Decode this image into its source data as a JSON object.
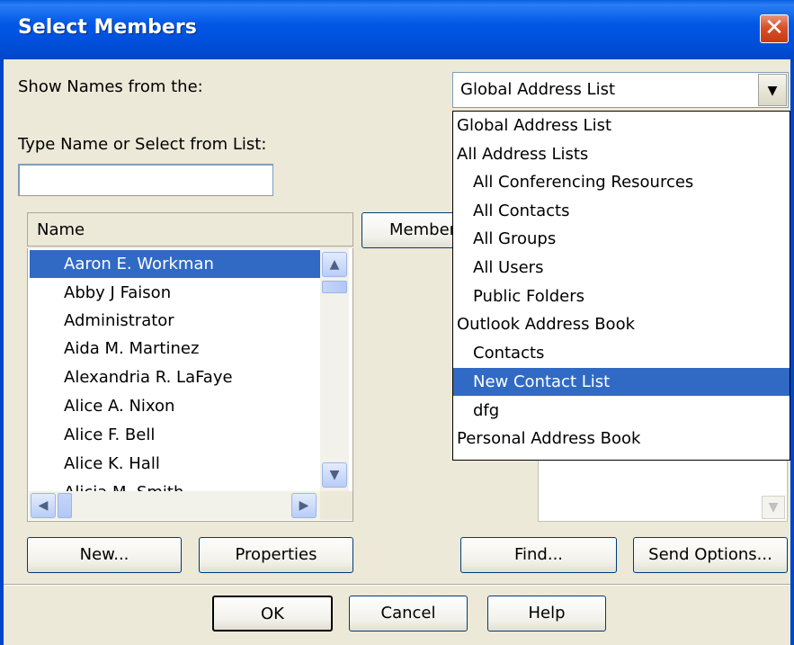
{
  "window": {
    "title": "Select Members",
    "close_glyph": "✕"
  },
  "show_names": {
    "label": "Show Names from the:",
    "selected": "Global Address List"
  },
  "search": {
    "label": "Type Name or Select from List:",
    "value": ""
  },
  "name_list": {
    "column_header": "Name",
    "rows": [
      "Aaron E. Workman",
      "Abby J Faison",
      "Administrator",
      "Aida M. Martinez",
      "Alexandria R. LaFaye",
      "Alice A. Nixon",
      "Alice F. Bell",
      "Alice K. Hall",
      "Alicia M. Smith"
    ],
    "selected_index": 0
  },
  "members_button": "Members",
  "dropdown_options": [
    {
      "label": "Global Address List",
      "level": 0
    },
    {
      "label": "All Address Lists",
      "level": 0
    },
    {
      "label": "All Conferencing Resources",
      "level": 1
    },
    {
      "label": "All Contacts",
      "level": 1
    },
    {
      "label": "All Groups",
      "level": 1
    },
    {
      "label": "All Users",
      "level": 1
    },
    {
      "label": "Public Folders",
      "level": 1
    },
    {
      "label": "Outlook Address Book",
      "level": 0
    },
    {
      "label": "Contacts",
      "level": 1
    },
    {
      "label": "New Contact List",
      "level": 1,
      "highlighted": true
    },
    {
      "label": "dfg",
      "level": 1
    },
    {
      "label": "Personal Address Book",
      "level": 0
    }
  ],
  "buttons": {
    "new": "New...",
    "properties": "Properties",
    "find": "Find...",
    "send_options": "Send Options...",
    "ok": "OK",
    "cancel": "Cancel",
    "help": "Help"
  },
  "colors": {
    "titlebar": "#0058e6",
    "selection": "#316ac5",
    "dialog_bg": "#ece9d8"
  },
  "icons": {
    "close": "close-icon",
    "dropdown_arrow": "chevron-down-icon",
    "scroll_up": "chevron-up-icon",
    "scroll_down": "chevron-down-icon",
    "scroll_left": "chevron-left-icon",
    "scroll_right": "chevron-right-icon"
  }
}
